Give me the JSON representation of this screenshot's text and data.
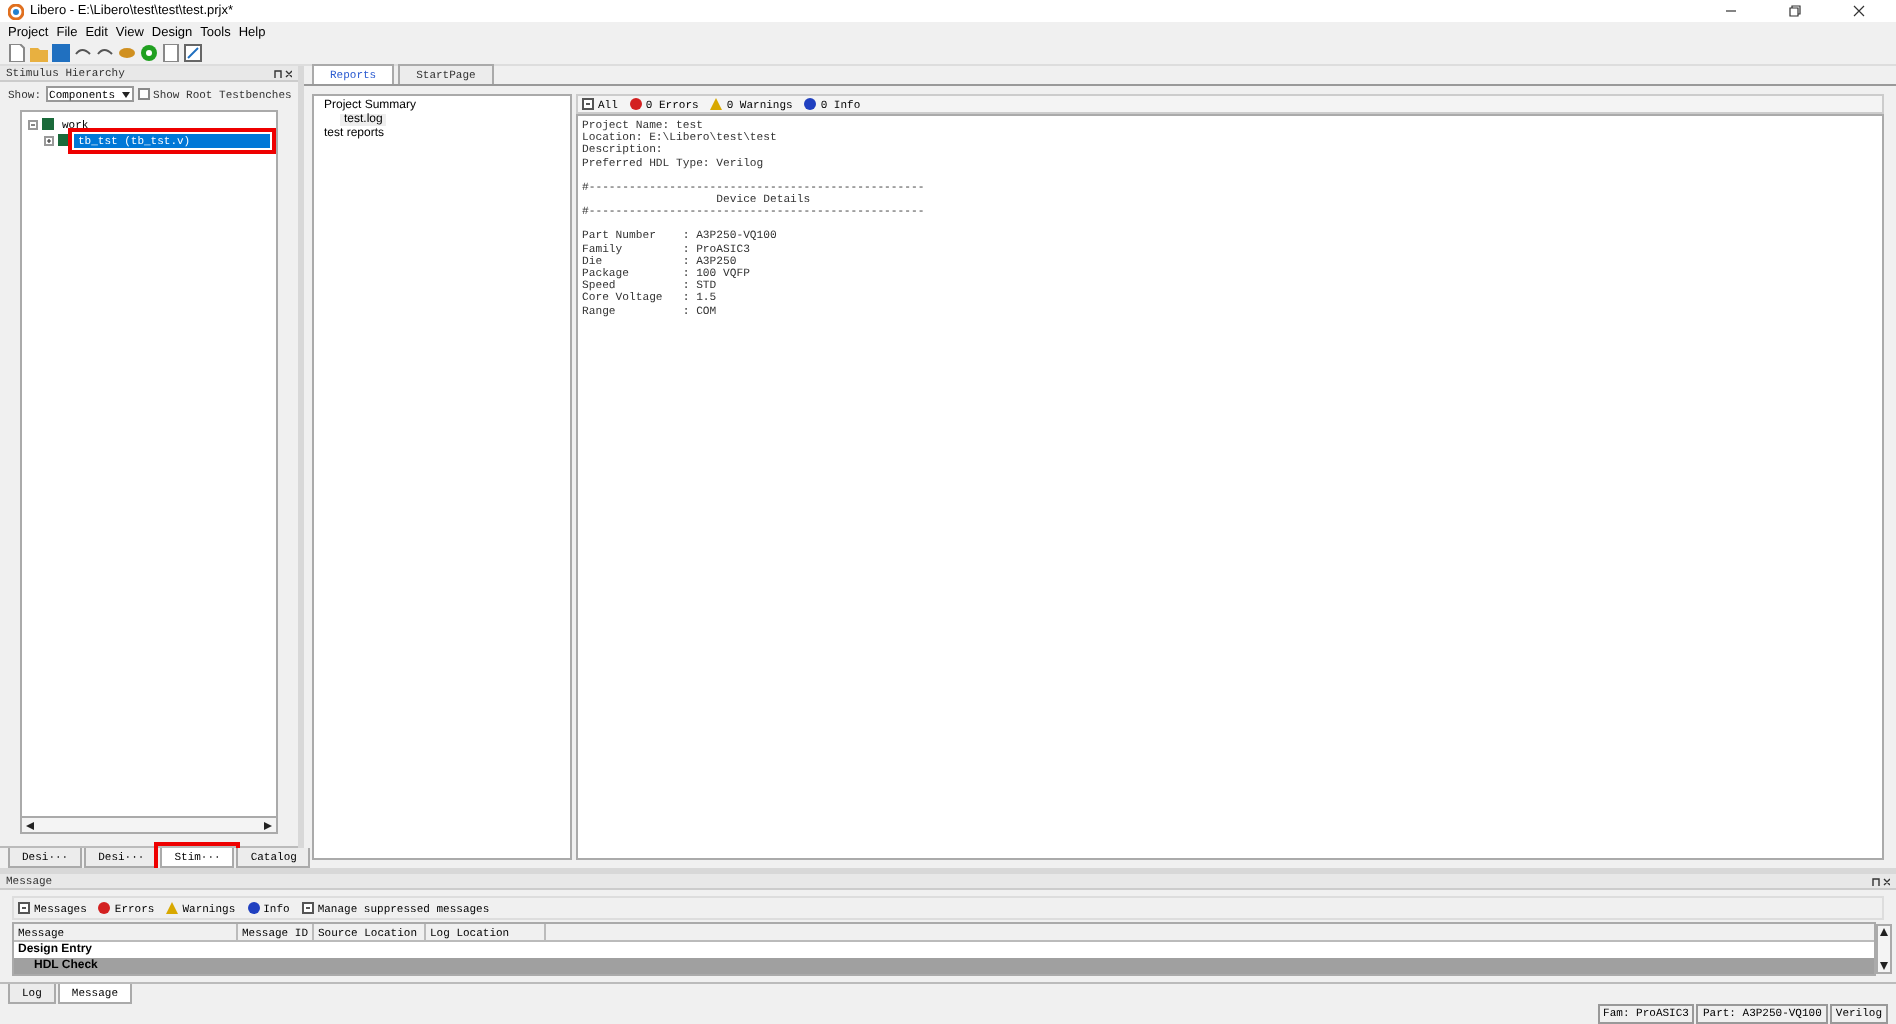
{
  "window": {
    "title": "Libero - E:\\Libero\\test\\test\\test.prjx*"
  },
  "menu": [
    "Project",
    "File",
    "Edit",
    "View",
    "Design",
    "Tools",
    "Help"
  ],
  "stimulus_panel": {
    "title": "Stimulus Hierarchy",
    "show_label": "Show:",
    "show_value": "Components",
    "root_testbenches": {
      "label": "Show Root Testbenches",
      "checked": false
    },
    "tree": [
      {
        "label": "work",
        "expanded": true,
        "selected": false,
        "highlighted": false,
        "children": [
          {
            "label": "tb_tst (tb_tst.v)",
            "expanded": false,
            "selected": true,
            "highlighted": true
          }
        ]
      }
    ],
    "tabs": [
      {
        "label": "Desi···",
        "selected": false,
        "highlighted": false
      },
      {
        "label": "Desi···",
        "selected": false,
        "highlighted": false
      },
      {
        "label": "Stim···",
        "selected": true,
        "highlighted": true
      },
      {
        "label": "Catalog",
        "selected": false,
        "highlighted": false
      }
    ]
  },
  "doc_tabs": [
    {
      "label": "Reports",
      "selected": true
    },
    {
      "label": "StartPage",
      "selected": false
    }
  ],
  "reports_tree": [
    {
      "label": "Project Summary",
      "selected": false,
      "children": [
        {
          "label": "test.log",
          "selected": true
        }
      ]
    },
    {
      "label": "test reports",
      "selected": false
    }
  ],
  "log_filters": [
    {
      "kind": "all",
      "label": "All"
    },
    {
      "kind": "error",
      "label": "0 Errors"
    },
    {
      "kind": "warning",
      "label": "0 Warnings"
    },
    {
      "kind": "info",
      "label": "0 Info"
    }
  ],
  "log_blocks": [
    [
      "Project Name: test",
      "Location: E:\\Libero\\test\\test",
      "Description:",
      "Preferred HDL Type: Verilog"
    ],
    [
      "#--------------------------------------------------",
      "                    Device Details",
      "#--------------------------------------------------"
    ],
    [
      "Part Number    : A3P250-VQ100",
      "Family         : ProASIC3",
      "Die            : A3P250",
      "Package        : 100 VQFP",
      "Speed          : STD",
      "Core Voltage   : 1.5",
      "Range          : COM"
    ]
  ],
  "message_panel": {
    "title": "Message",
    "filters": [
      {
        "kind": "all",
        "label": "Messages"
      },
      {
        "kind": "error",
        "label": "Errors"
      },
      {
        "kind": "warning",
        "label": "Warnings"
      },
      {
        "kind": "info",
        "label": "Info"
      },
      {
        "kind": "all",
        "label": "Manage suppressed messages"
      }
    ],
    "columns": [
      "Message",
      "Message ID",
      "Source Location",
      "Log Location"
    ],
    "rows": [
      {
        "label": "Design Entry",
        "selected": false,
        "children": [
          {
            "label": "HDL Check",
            "selected": true
          }
        ]
      }
    ],
    "tabs": [
      {
        "label": "Log",
        "selected": false
      },
      {
        "label": "Message",
        "selected": true
      }
    ]
  },
  "status_bar": [
    "Fam: ProASIC3",
    "Part: A3P250-VQ100",
    "Verilog"
  ]
}
